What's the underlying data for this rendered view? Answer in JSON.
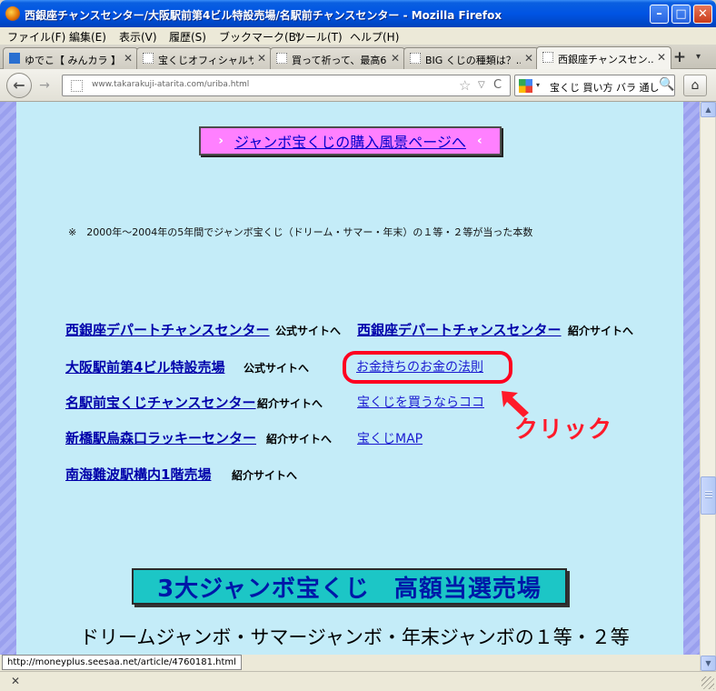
{
  "window": {
    "title": "西銀座チャンスセンター/大阪駅前第4ビル特設売場/名駅前チャンスセンター - Mozilla Firefox",
    "min_glyph": "–",
    "max_glyph": "□",
    "close_glyph": "✕"
  },
  "menu": [
    "ファイル(F)",
    "編集(E)",
    "表示(V)",
    "履歴(S)",
    "ブックマーク(B)",
    "ツール(T)",
    "ヘルプ(H)"
  ],
  "tabs": [
    {
      "label": "ゆでこ【 みんカラ 】...",
      "close": "✕"
    },
    {
      "label": "宝くじオフィシャルサ...",
      "close": "✕"
    },
    {
      "label": "買って祈って、最高6...",
      "close": "✕"
    },
    {
      "label": "BIG くじの種類は？...",
      "close": "✕"
    },
    {
      "label": "西銀座チャンスセン...",
      "close": "✕"
    }
  ],
  "new_tab": "+",
  "tab_list": "▾",
  "nav": {
    "back": "←",
    "forward": "→",
    "url": "www.takarakuji-atarita.com/uriba.html",
    "star": "☆",
    "dropdown": "▽",
    "reload": "C",
    "search_engine_drop": "▾",
    "search_text": "宝くじ 買い方 バラ 通し",
    "search_glass": "🔍",
    "home": "⌂"
  },
  "page": {
    "jumbo_button": {
      "arrow_left": "›",
      "label": "ジャンボ宝くじの購入風景ページへ",
      "arrow_right": "‹"
    },
    "note": "※　2000年～2004年の5年間でジャンボ宝くじ（ドリーム・サマー・年末）の１等・２等が当った本数",
    "shops": [
      {
        "name": "西銀座デパートチャンスセンター",
        "suffix": "公式サイトへ"
      },
      {
        "name": "大阪駅前第4ビル特設売場",
        "suffix": "公式サイトへ"
      },
      {
        "name": "名駅前宝くじチャンスセンター",
        "suffix": "紹介サイトへ"
      },
      {
        "name": "新橋駅烏森口ラッキーセンター",
        "suffix": "紹介サイトへ"
      },
      {
        "name": "南海難波駅構内1階売場",
        "suffix": "紹介サイトへ"
      }
    ],
    "shop_right": {
      "name": "西銀座デパートチャンスセンター",
      "suffix": "紹介サイトへ"
    },
    "right_links": [
      "お金持ちのお金の法則",
      "宝くじを買うならココ",
      "宝くじMAP"
    ],
    "annotation": "クリック",
    "banner": "3大ジャンボ宝くじ　高額当選売場",
    "subheading": "ドリームジャンボ・サマージャンボ・年末ジャンボの１等・２等"
  },
  "scrollbar": {
    "up": "▲",
    "down": "▼"
  },
  "status": "http://moneyplus.seesaa.net/article/4760181.html",
  "addon_close": "✕",
  "colors": {
    "page_bg": "#c4ecf8",
    "annotation_red": "#ff1a2a",
    "banner_bg": "#1cc6c6",
    "jumbo_bg": "#ff80ff"
  }
}
